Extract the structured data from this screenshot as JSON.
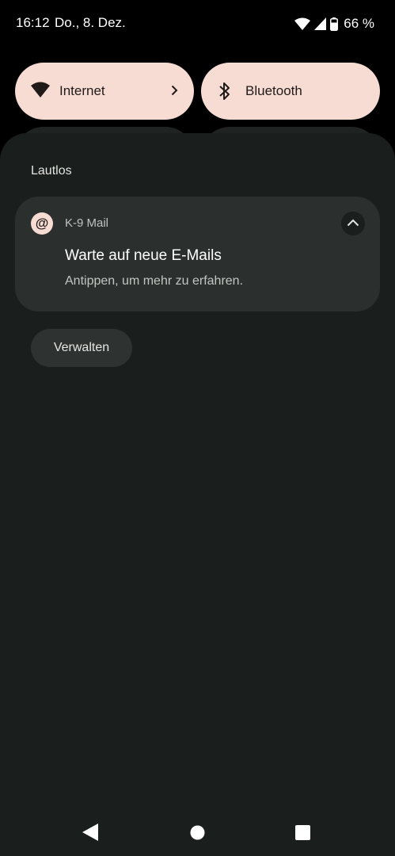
{
  "status_bar": {
    "time": "16:12",
    "date": "Do., 8. Dez.",
    "battery_text": "66 %",
    "icons": [
      "wifi-icon",
      "signal-icon",
      "battery-icon"
    ]
  },
  "quick_settings": {
    "tiles": [
      {
        "label": "Internet",
        "icon": "wifi-icon",
        "has_chevron": true
      },
      {
        "label": "Bluetooth",
        "icon": "bluetooth-icon",
        "has_chevron": false
      }
    ]
  },
  "notifications": {
    "section_title": "Lautlos",
    "items": [
      {
        "app_name": "K-9 Mail",
        "app_icon_glyph": "@",
        "title": "Warte auf neue E-Mails",
        "text": "Antippen, um mehr zu erfahren."
      }
    ],
    "manage_label": "Verwalten"
  },
  "nav_bar": {
    "buttons": [
      "back-icon",
      "home-icon",
      "recents-icon"
    ]
  },
  "colors": {
    "tile_accent": "#f7dcd4",
    "shade_background": "#1a1f1d",
    "notification_background": "#2b302e"
  }
}
